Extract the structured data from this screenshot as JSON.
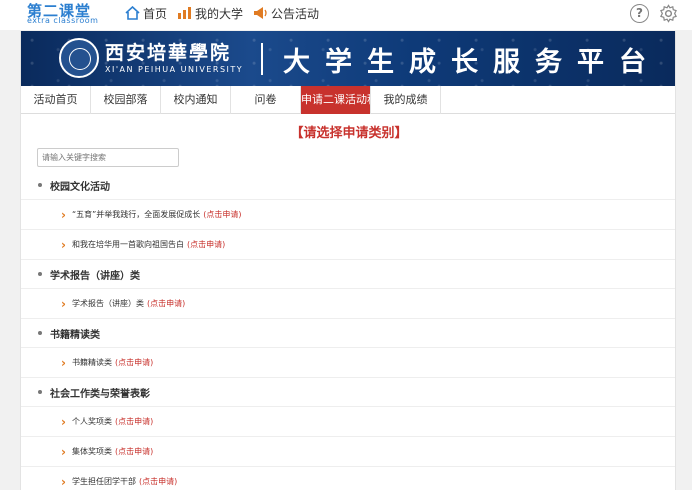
{
  "logo": {
    "cn": "第二课堂",
    "en": "extra classroom"
  },
  "topnav": [
    {
      "label": "首页",
      "icon": "home-icon"
    },
    {
      "label": "我的大学",
      "icon": "chart-icon"
    },
    {
      "label": "公告活动",
      "icon": "megaphone-icon"
    }
  ],
  "banner": {
    "school_cn": "西安培華學院",
    "school_en": "XI'AN PEIHUA UNIVERSITY",
    "platform": "大学生成长服务平台"
  },
  "tabs": [
    "活动首页",
    "校园部落",
    "校内通知",
    "问卷",
    "申请二课活动积",
    "我的成绩"
  ],
  "active_tab": 4,
  "heading": "【请选择申请类别】",
  "search": {
    "placeholder": "请输入关键字搜索"
  },
  "apply_label": "(点击申请)",
  "categories": [
    {
      "title": "校园文化活动",
      "items": [
        "“五育”并举我践行，全面发展促成长",
        "和我在培华用一首歌向祖国告白"
      ]
    },
    {
      "title": "学术报告（讲座）类",
      "items": [
        "学术报告（讲座）类"
      ]
    },
    {
      "title": "书籍精读类",
      "items": [
        "书籍精读类"
      ]
    },
    {
      "title": "社会工作类与荣誉表彰",
      "items": [
        "个人奖项类",
        "集体奖项类",
        "学生担任团学干部"
      ]
    }
  ],
  "colors": {
    "accent": "#c8322d",
    "brand_blue": "#2c7fd0",
    "chevron": "#e07b22"
  }
}
